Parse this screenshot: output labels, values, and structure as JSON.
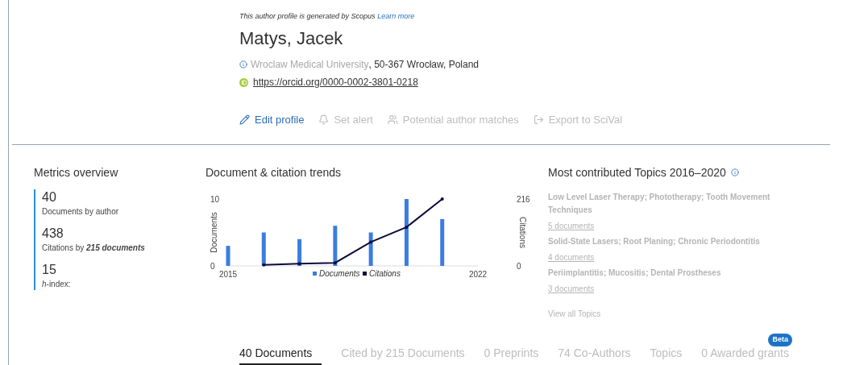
{
  "notice": {
    "text": "This author profile is generated by Scopus",
    "link": "Learn more"
  },
  "author": {
    "name": "Matys, Jacek",
    "affiliation": "Wroclaw Medical University",
    "location": ", 50-367 Wrocław, Poland",
    "orcid": "https://orcid.org/0000-0002-3801-0218"
  },
  "actions": [
    {
      "label": "Edit profile",
      "disabled": false
    },
    {
      "label": "Set alert",
      "disabled": true
    },
    {
      "label": "Potential author matches",
      "disabled": true
    },
    {
      "label": "Export to SciVal",
      "disabled": true
    }
  ],
  "metrics": {
    "title": "Metrics overview",
    "items": [
      {
        "value": "40",
        "label": "Documents by author"
      },
      {
        "value": "438",
        "label": "Citations by **215 documents**"
      },
      {
        "value": "15",
        "label": "*h*-index:"
      }
    ]
  },
  "trends": {
    "title": "Document & citation trends",
    "chart_data": {
      "type": "bar",
      "xlabel": null,
      "ylabel": "Documents",
      "x": [
        2015,
        2016,
        2017,
        2018,
        2019,
        2020,
        2021
      ],
      "xlim": [
        2015,
        2022
      ],
      "xticks": [
        2015,
        2022
      ],
      "ylim": [
        0,
        10
      ],
      "yticks": [
        0,
        10
      ],
      "y2label": "Citations",
      "y2lim": [
        0,
        216
      ],
      "y2ticks": [
        0,
        216
      ],
      "legend": "bottom",
      "series": [
        {
          "name": "Documents",
          "type": "bar",
          "color": "#3b7de0",
          "values": [
            3,
            5,
            4,
            6,
            5,
            10,
            7
          ]
        },
        {
          "name": "Citations",
          "type": "line",
          "axis": "y2",
          "color": "#0c0c3c",
          "values": [
            null,
            3,
            7,
            10,
            77,
            125,
            216
          ]
        }
      ]
    }
  },
  "topics": {
    "title": "Most contributed Topics 2016–2020",
    "items": [
      {
        "name": "Low Level Laser Therapy; Phototherapy; Tooth Movement Techniques",
        "count": "5 documents"
      },
      {
        "name": "Solid-State Lasers; Root Planing; Chronic Periodontitis",
        "count": "4 documents"
      },
      {
        "name": "Periimplantitis; Mucositis; Dental Prostheses",
        "count": "3 documents"
      }
    ],
    "view_all": "View all Topics"
  },
  "tabs": [
    {
      "label": "40 Documents",
      "selected": true
    },
    {
      "label": "Cited by 215 Documents",
      "selected": false
    },
    {
      "label": "0 Preprints",
      "selected": false
    },
    {
      "label": "74 Co-Authors",
      "selected": false
    },
    {
      "label": "Topics",
      "selected": false
    },
    {
      "label": "0 Awarded grants",
      "selected": false,
      "badge": "Beta"
    }
  ]
}
